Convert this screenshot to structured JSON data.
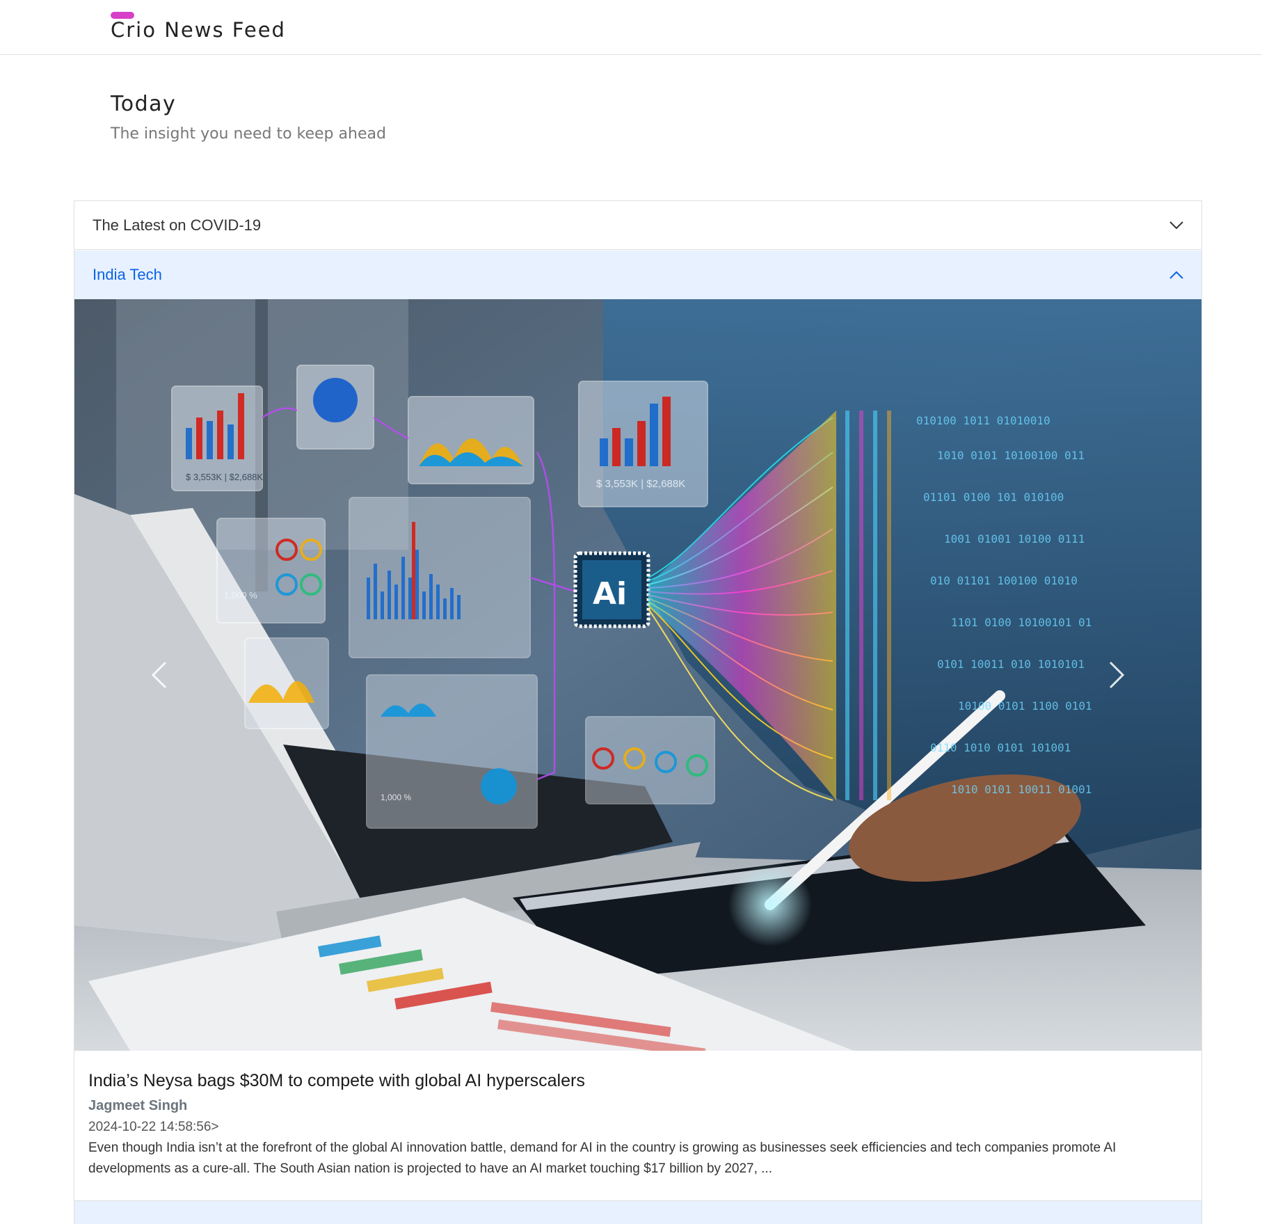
{
  "navbar": {
    "brand": "Crio News Feed",
    "accent_color": "#d63fc8"
  },
  "header": {
    "title": "Today",
    "subtitle": "The insight you need to keep ahead"
  },
  "accordion": {
    "sections": [
      {
        "label": "The Latest on COVID-19",
        "state": "collapsed",
        "icon": "chevron-down-icon"
      },
      {
        "label": "India Tech",
        "state": "expanded",
        "icon": "chevron-up-icon",
        "accent_color": "#0c63e4"
      }
    ]
  },
  "carousel": {
    "prev_icon": "chevron-left-icon",
    "next_icon": "chevron-right-icon",
    "image": {
      "chip_text": "Ai",
      "panel_values": [
        "$ 3,553K | $2,688K",
        "1,000 %",
        "$ 3,553K | $2,688K",
        "1,000 %"
      ]
    }
  },
  "article": {
    "title": "India’s Neysa bags $30M to compete with global AI hyperscalers",
    "author": "Jagmeet Singh",
    "date": "2024-10-22 14:58:56>",
    "description": "Even though India isn’t at the forefront of the global AI innovation battle, demand for AI in the country is growing as businesses seek efficiencies and tech companies promote AI developments as a cure-all. The South Asian nation is projected to have an AI market touching $17 billion by 2027, ..."
  }
}
